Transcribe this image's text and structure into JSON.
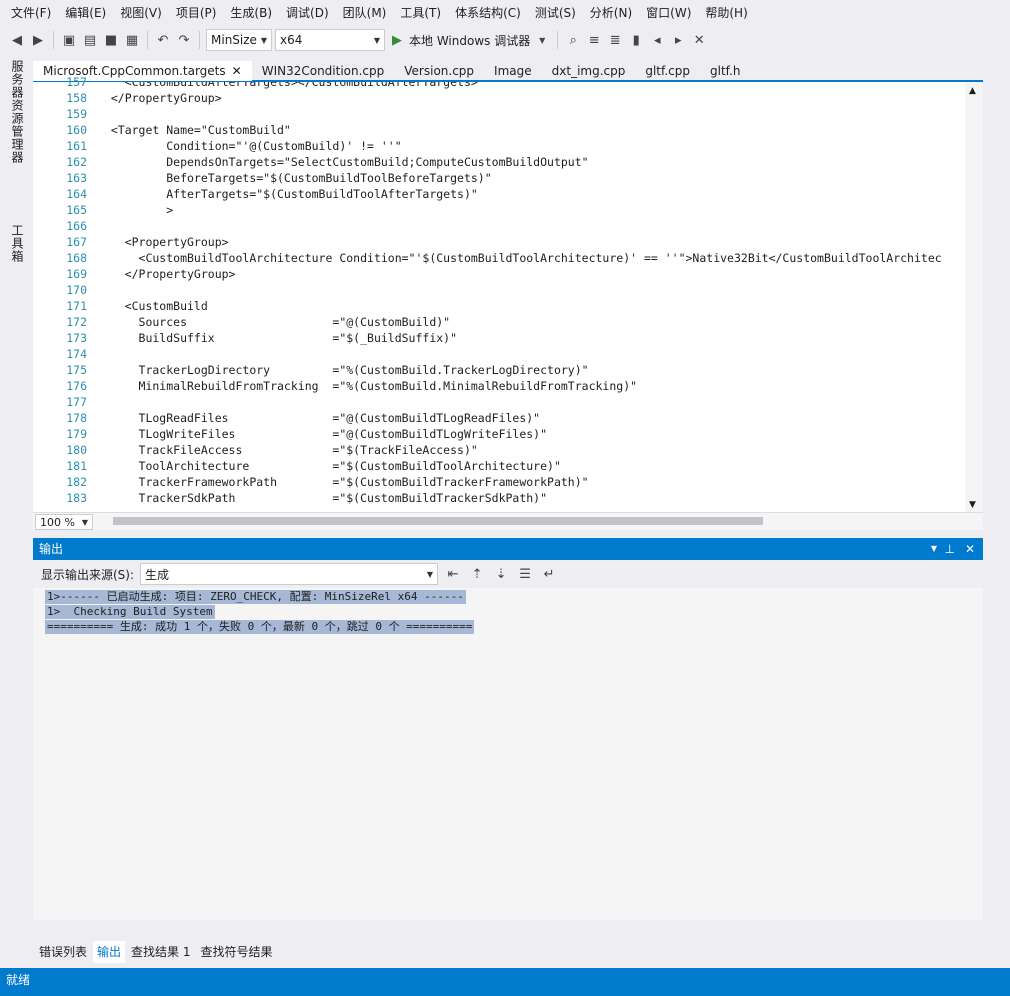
{
  "menu": [
    "文件(F)",
    "编辑(E)",
    "视图(V)",
    "项目(P)",
    "生成(B)",
    "调试(D)",
    "团队(M)",
    "工具(T)",
    "体系结构(C)",
    "测试(S)",
    "分析(N)",
    "窗口(W)",
    "帮助(H)"
  ],
  "toolbar": {
    "config": "MinSize",
    "platform": "x64",
    "run_label": "本地 Windows 调试器"
  },
  "side_tabs": [
    "服务器资源管理器",
    "工具箱"
  ],
  "tabs": [
    {
      "label": "Microsoft.CppCommon.targets",
      "active": true
    },
    {
      "label": "WIN32Condition.cpp"
    },
    {
      "label": "Version.cpp"
    },
    {
      "label": "Image"
    },
    {
      "label": "dxt_img.cpp"
    },
    {
      "label": "gltf.cpp"
    },
    {
      "label": "gltf.h"
    }
  ],
  "editor": {
    "zoom": "100 %",
    "lines": [
      {
        "n": "157",
        "t": "    <CustomBuildAfterTargets></CustomBuildAfterTargets>"
      },
      {
        "n": "158",
        "t": "  </PropertyGroup>"
      },
      {
        "n": "159",
        "t": ""
      },
      {
        "n": "160",
        "t": "  <Target Name=\"CustomBuild\""
      },
      {
        "n": "161",
        "t": "          Condition=\"'@(CustomBuild)' != ''\""
      },
      {
        "n": "162",
        "t": "          DependsOnTargets=\"SelectCustomBuild;ComputeCustomBuildOutput\""
      },
      {
        "n": "163",
        "t": "          BeforeTargets=\"$(CustomBuildToolBeforeTargets)\""
      },
      {
        "n": "164",
        "t": "          AfterTargets=\"$(CustomBuildToolAfterTargets)\""
      },
      {
        "n": "165",
        "t": "          >"
      },
      {
        "n": "166",
        "t": ""
      },
      {
        "n": "167",
        "t": "    <PropertyGroup>"
      },
      {
        "n": "168",
        "t": "      <CustomBuildToolArchitecture Condition=\"'$(CustomBuildToolArchitecture)' == ''\">Native32Bit</CustomBuildToolArchitec"
      },
      {
        "n": "169",
        "t": "    </PropertyGroup>"
      },
      {
        "n": "170",
        "t": ""
      },
      {
        "n": "171",
        "t": "    <CustomBuild"
      },
      {
        "n": "172",
        "t": "      Sources                     =\"@(CustomBuild)\""
      },
      {
        "n": "173",
        "t": "      BuildSuffix                 =\"$(_BuildSuffix)\""
      },
      {
        "n": "174",
        "t": ""
      },
      {
        "n": "175",
        "t": "      TrackerLogDirectory         =\"%(CustomBuild.TrackerLogDirectory)\""
      },
      {
        "n": "176",
        "t": "      MinimalRebuildFromTracking  =\"%(CustomBuild.MinimalRebuildFromTracking)\""
      },
      {
        "n": "177",
        "t": ""
      },
      {
        "n": "178",
        "t": "      TLogReadFiles               =\"@(CustomBuildTLogReadFiles)\""
      },
      {
        "n": "179",
        "t": "      TLogWriteFiles              =\"@(CustomBuildTLogWriteFiles)\""
      },
      {
        "n": "180",
        "t": "      TrackFileAccess             =\"$(TrackFileAccess)\""
      },
      {
        "n": "181",
        "t": "      ToolArchitecture            =\"$(CustomBuildToolArchitecture)\""
      },
      {
        "n": "182",
        "t": "      TrackerFrameworkPath        =\"$(CustomBuildTrackerFrameworkPath)\""
      },
      {
        "n": "183",
        "t": "      TrackerSdkPath              =\"$(CustomBuildTrackerSdkPath)\""
      }
    ]
  },
  "output": {
    "title": "输出",
    "source_label": "显示输出来源(S):",
    "source_value": "生成",
    "lines": [
      "1>------ 已启动生成: 项目: ZERO_CHECK, 配置: MinSizeRel x64 ------",
      "1>  Checking Build System",
      "========== 生成: 成功 1 个，失败 0 个，最新 0 个，跳过 0 个 =========="
    ]
  },
  "bottom_tabs": [
    "错误列表",
    "输出",
    "查找结果 1",
    "查找符号结果"
  ],
  "status": "就绪"
}
